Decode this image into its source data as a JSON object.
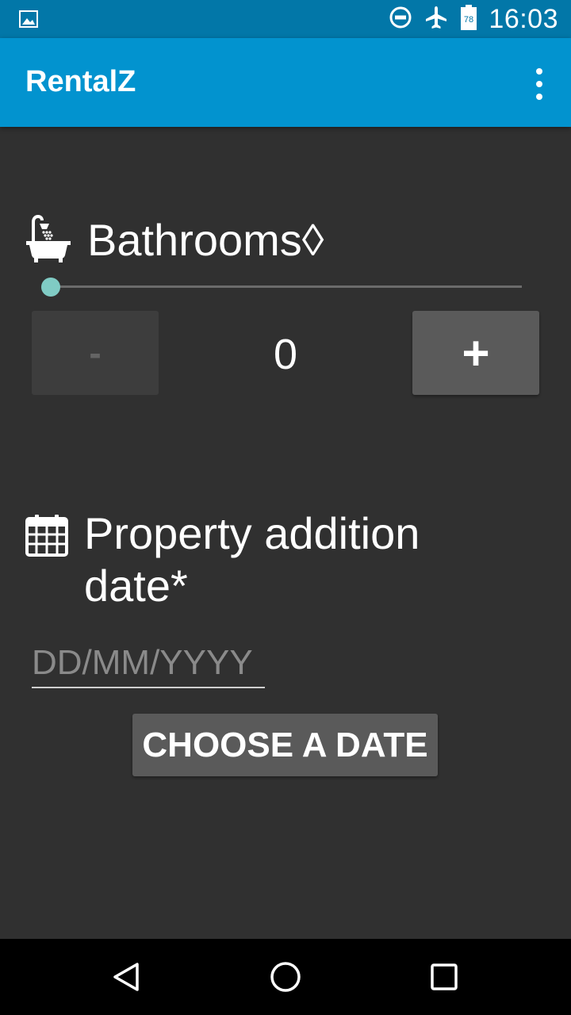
{
  "status_bar": {
    "time": "16:03",
    "battery_level": "78",
    "icons": [
      "image-notification-icon",
      "do-not-disturb-icon",
      "airplane-mode-icon",
      "battery-icon"
    ]
  },
  "app_bar": {
    "title": "RentalZ",
    "menu_icon": "overflow-menu-icon",
    "color": "#0293cf"
  },
  "bathrooms": {
    "icon": "bathtub-icon",
    "label": "Bathrooms◊",
    "slider_value": 0,
    "minus_label": "-",
    "count": "0",
    "plus_label": "+"
  },
  "property_date": {
    "icon": "calendar-icon",
    "label": "Property addition date*",
    "input_value": "",
    "input_placeholder": "DD/MM/YYYY",
    "choose_button_label": "CHOOSE A DATE"
  },
  "nav_bar": {
    "items": [
      "back-icon",
      "home-icon",
      "recents-icon"
    ]
  },
  "colors": {
    "background": "#303030",
    "accent": "#80cbc4",
    "status_bar": "#0277a8"
  }
}
